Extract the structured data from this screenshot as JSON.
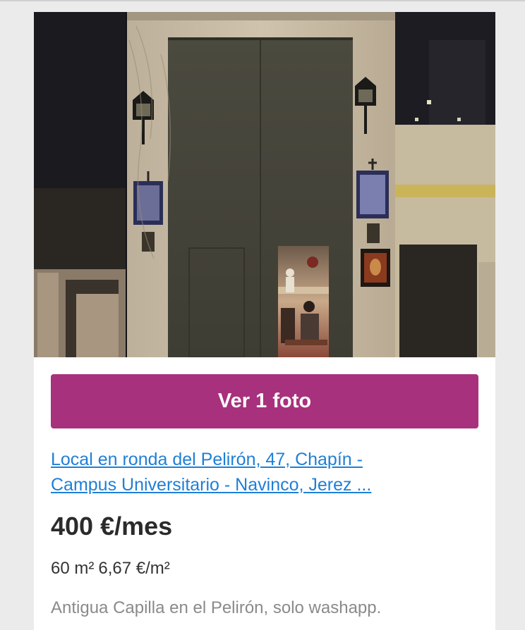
{
  "listing": {
    "photo_alt": "Capilla",
    "view_photos_label": "Ver 1 foto",
    "title_line1": "Local en ronda del Pelirón, 47, Chapín -",
    "title_line2": "Campus Universitario - Navinco, Jerez ...",
    "price": "400 €/mes",
    "area": "60 m²",
    "price_per_m2": "6,67 €/m²",
    "description": "Antigua Capilla en el Pelirón, solo washapp."
  },
  "colors": {
    "button": "#a8317d",
    "link": "#1f7fd6",
    "page_background": "#ebebeb"
  }
}
